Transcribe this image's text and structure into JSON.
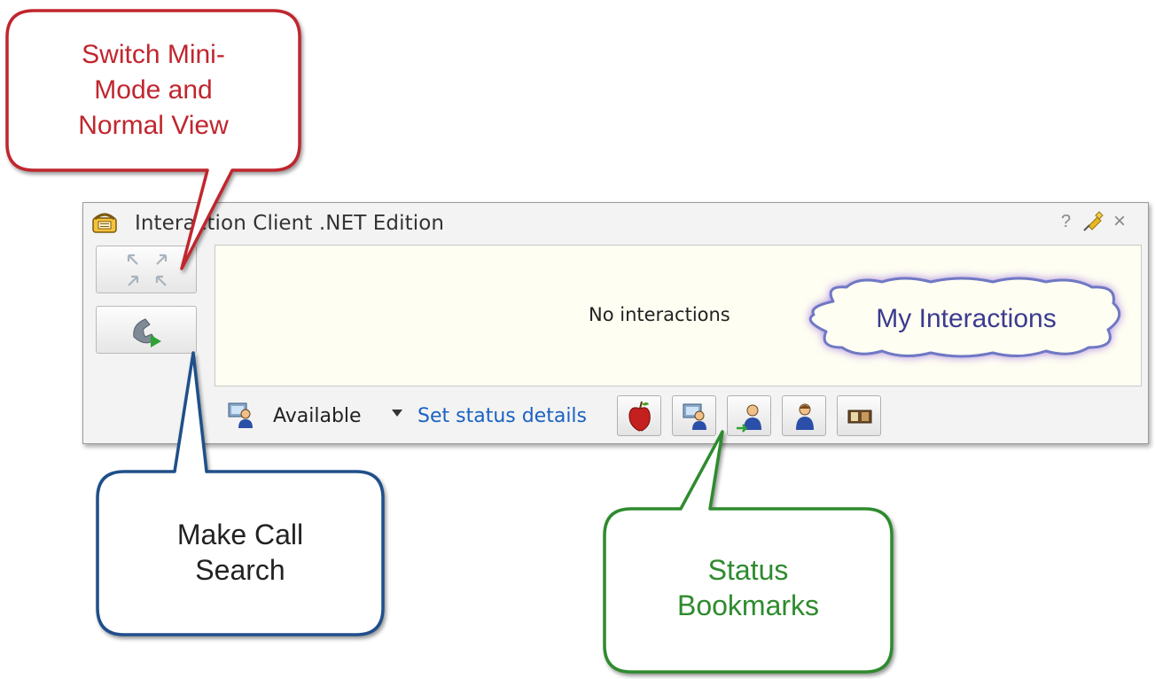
{
  "window": {
    "title": "Interaction Client .NET Edition",
    "help_label": "?",
    "close_label": "×",
    "icons": {
      "app": "telephone-icon",
      "help": "help-icon",
      "pin": "pin-icon",
      "close": "close-icon",
      "mode_switch": "expand-collapse-arrows-icon",
      "make_call": "phone-play-icon"
    }
  },
  "interactions": {
    "empty_text": "No interactions"
  },
  "status": {
    "current": "Available",
    "set_details_link": "Set status details",
    "status_icon": "available-agent-icon",
    "bookmarks": [
      {
        "icon": "apple-icon"
      },
      {
        "icon": "agent-at-desk-icon"
      },
      {
        "icon": "agent-away-icon"
      },
      {
        "icon": "agent-icon"
      },
      {
        "icon": "door-icon"
      }
    ]
  },
  "callouts": {
    "mode_switch": {
      "text": [
        "Switch Mini-",
        "Mode and",
        "Normal View"
      ],
      "color": "#c0262e"
    },
    "make_call": {
      "text": [
        "Make Call",
        "Search"
      ],
      "color": "#1f4f8a"
    },
    "my_interactions": {
      "text": "My Interactions",
      "color": "#3b3b8f"
    },
    "status_bookmarks": {
      "text": [
        "Status",
        "Bookmarks"
      ],
      "color": "#2e8b2e"
    }
  }
}
